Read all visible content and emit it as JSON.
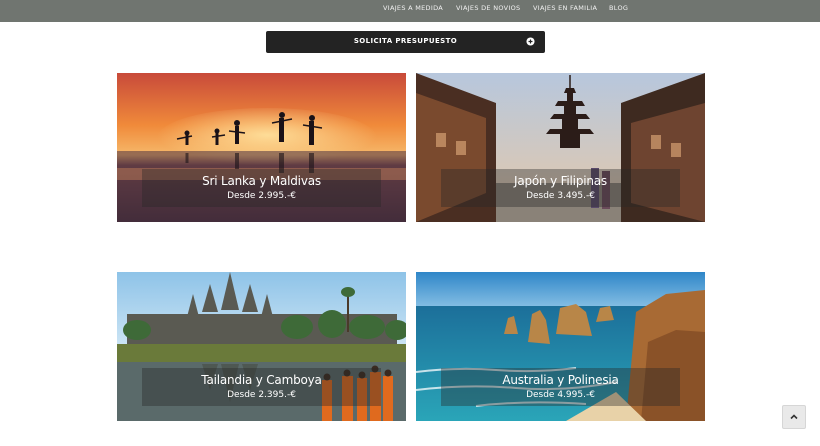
{
  "nav": {
    "items": [
      {
        "label": "VIAJES A MEDIDA"
      },
      {
        "label": "VIAJES DE NOVIOS"
      },
      {
        "label": "VIAJES EN FAMILIA"
      },
      {
        "label": "BLOG"
      }
    ]
  },
  "cta": {
    "label": "SOLICITA PRESUPUESTO",
    "icon": "plus-circle-icon"
  },
  "destinations": [
    {
      "title": "Sri Lanka y Maldivas",
      "price": "Desde 2.995.-€"
    },
    {
      "title": "Japón y Filipinas",
      "price": "Desde 3.495.-€"
    },
    {
      "title": "Tailandia y Camboya",
      "price": "Desde 2.395.-€"
    },
    {
      "title": "Australia y Polinesia",
      "price": "Desde 4.995.-€"
    }
  ],
  "back_to_top": {
    "icon": "chevron-up-icon"
  },
  "colors": {
    "topbar": "#707570",
    "cta_bg": "#232323"
  }
}
